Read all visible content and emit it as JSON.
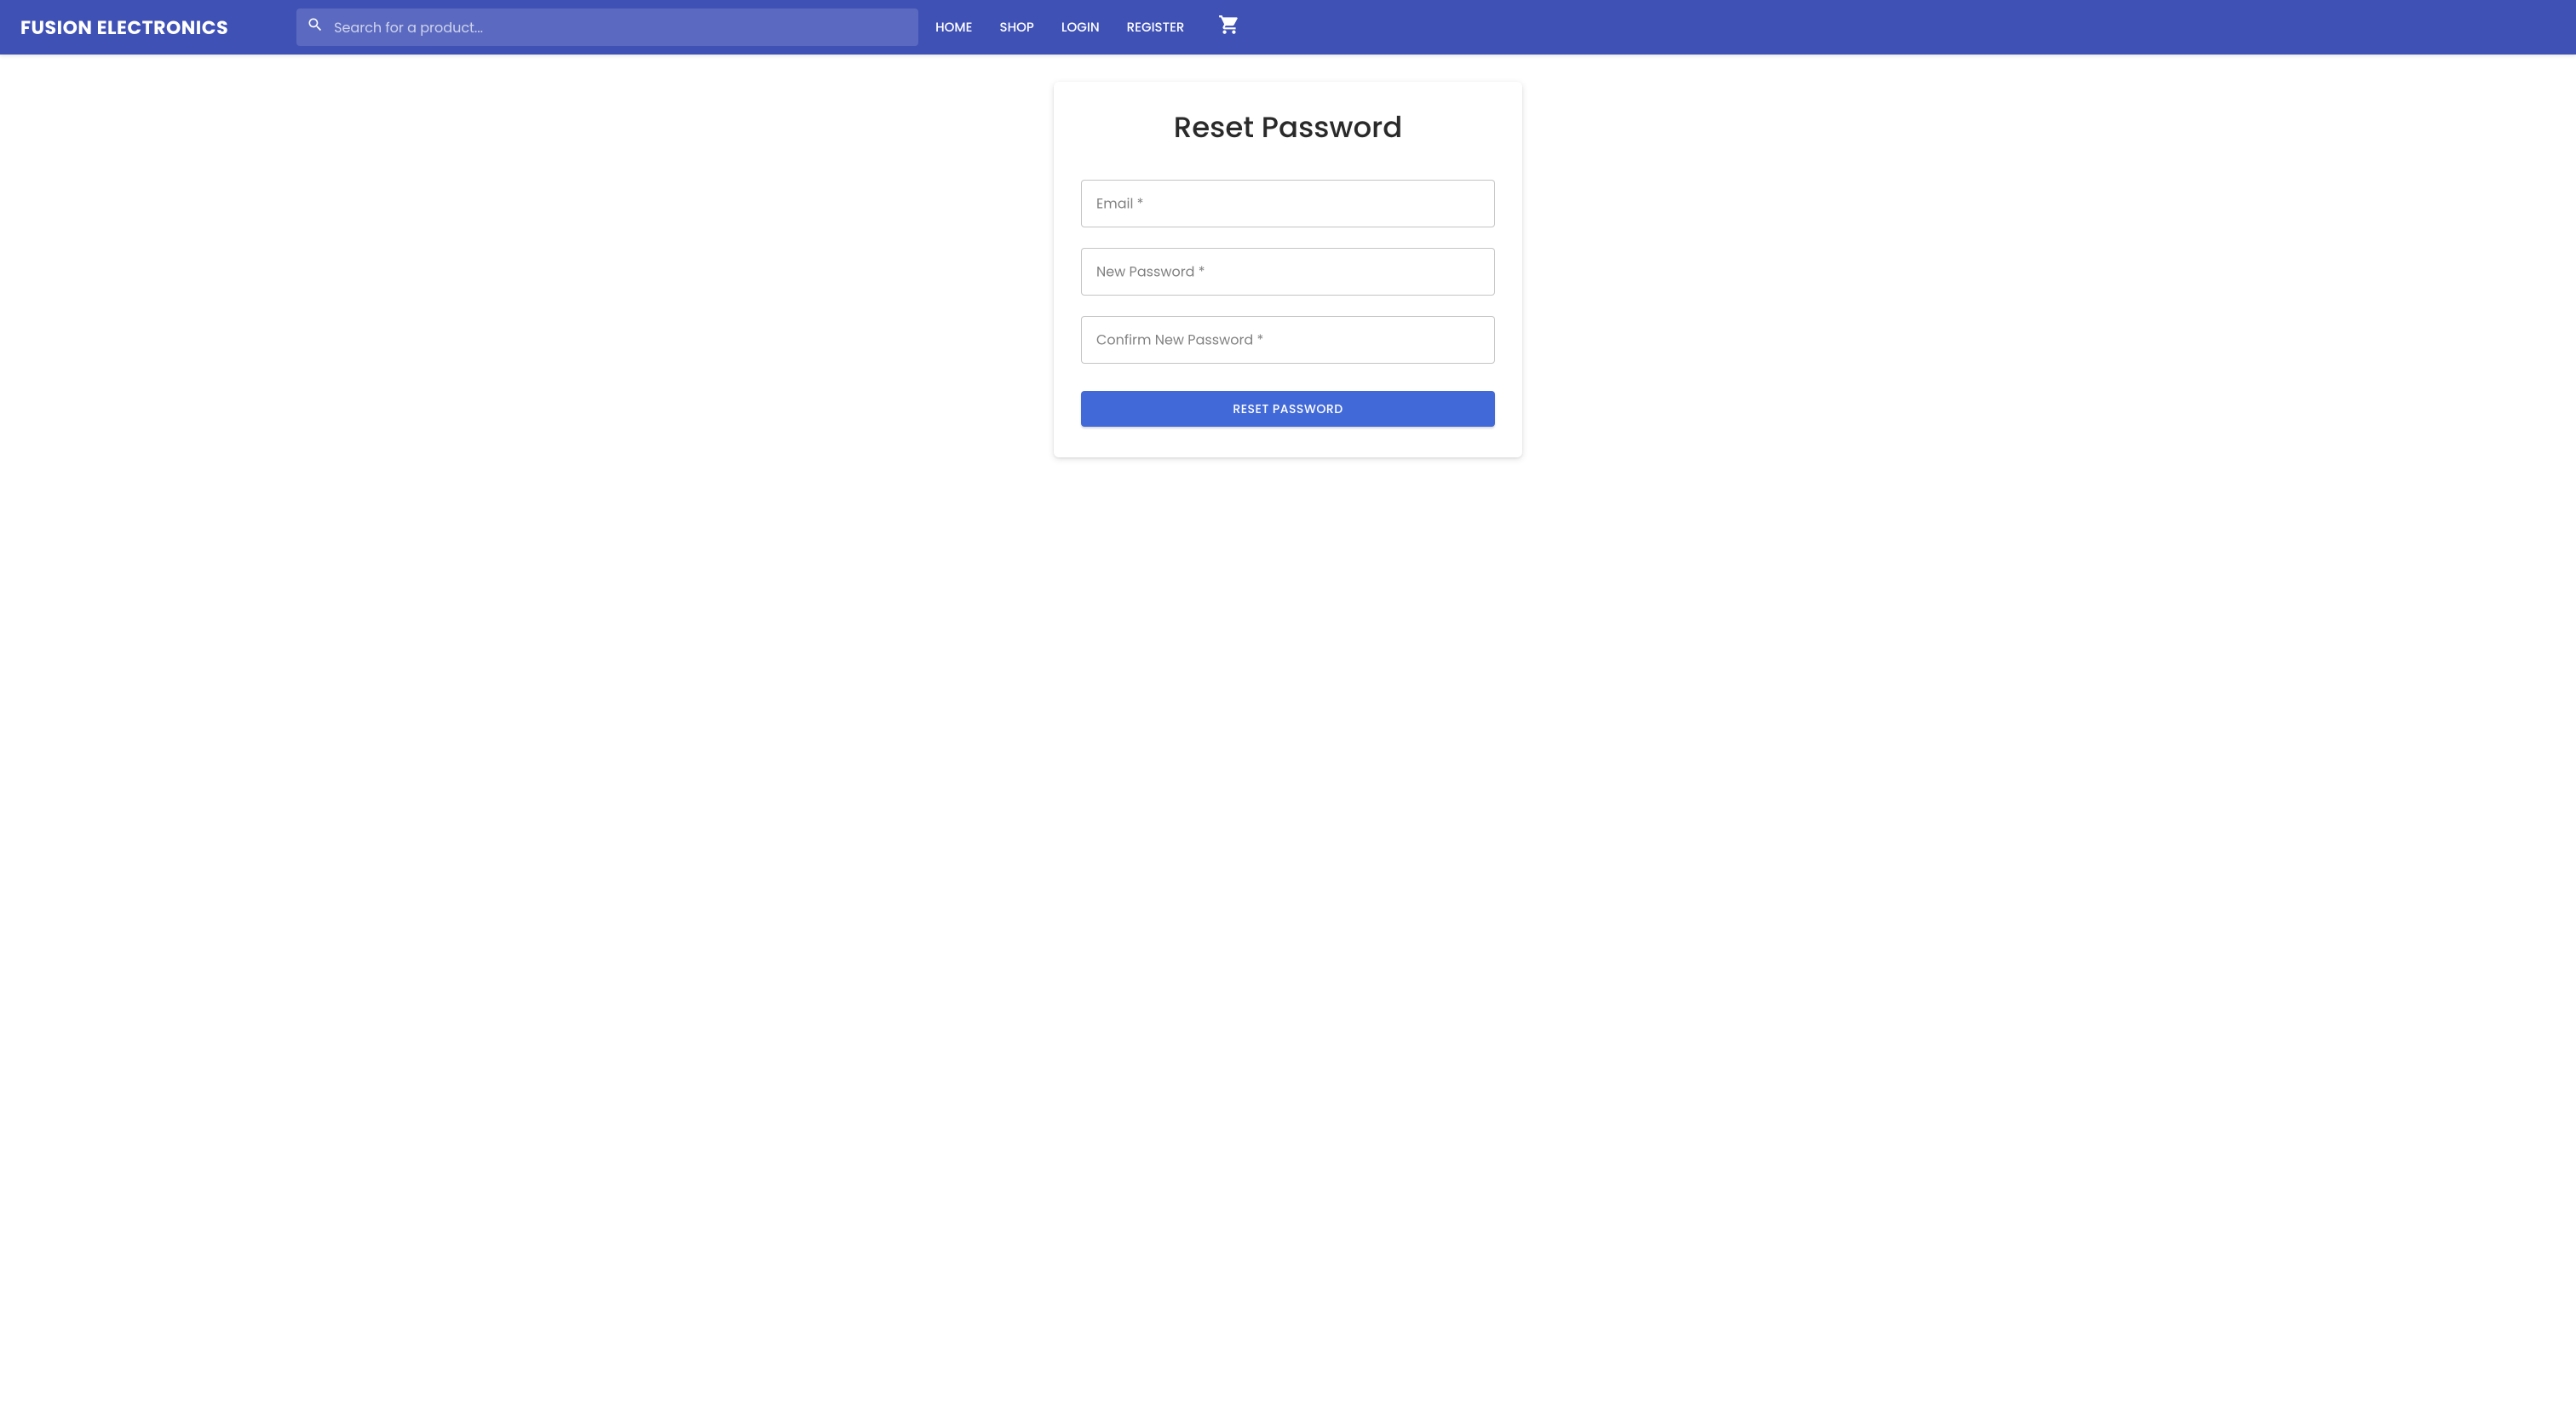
{
  "header": {
    "brand": "FUSION ELECTRONICS",
    "search_placeholder": "Search for a product...",
    "nav": {
      "home": "HOME",
      "shop": "SHOP",
      "login": "LOGIN",
      "register": "REGISTER"
    }
  },
  "card": {
    "title": "Reset Password",
    "fields": {
      "email_label": "Email *",
      "new_password_label": "New Password *",
      "confirm_password_label": "Confirm New Password *"
    },
    "submit_label": "RESET PASSWORD"
  }
}
